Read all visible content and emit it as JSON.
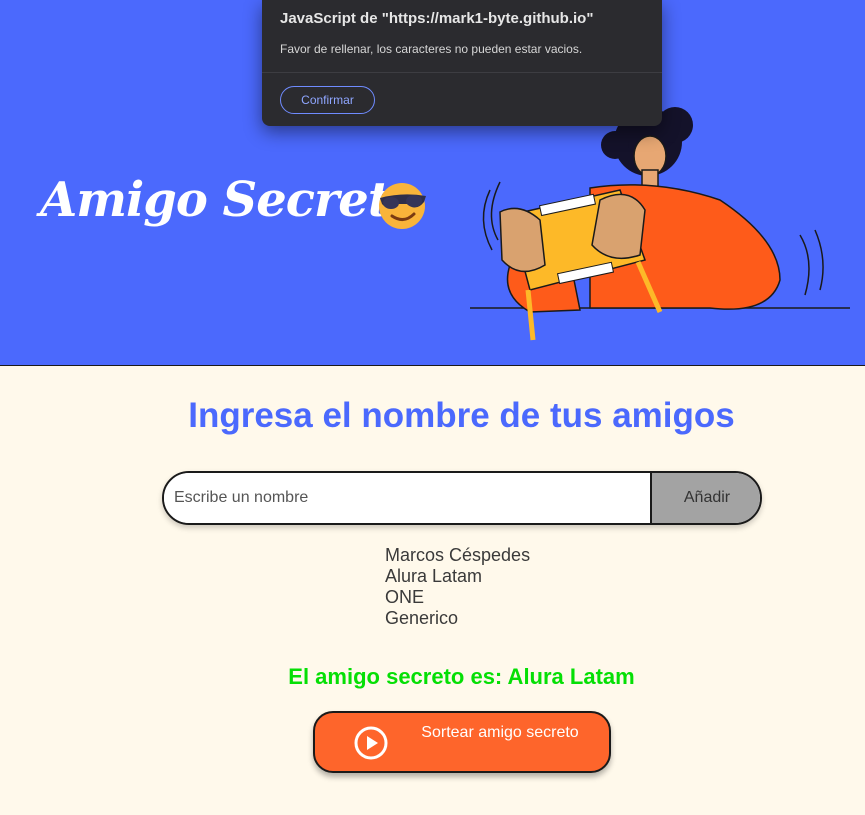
{
  "dialog": {
    "title": "JavaScript de \"https://mark1-byte.github.io\"",
    "message": "Favor de rellenar, los caracteres no pueden estar vacios.",
    "confirm_label": "Confirmar"
  },
  "header": {
    "title": "Amigo Secreto",
    "emoji_icon": "sunglasses-emoji-icon",
    "illustration_icon": "person-holding-gift-box-illustration"
  },
  "main": {
    "title": "Ingresa el nombre de tus amigos",
    "input_placeholder": "Escribe un nombre",
    "input_value": "",
    "add_label": "Añadir",
    "friends": [
      "Marcos Céspedes",
      "Alura Latam",
      "ONE",
      "Generico"
    ],
    "result": "El amigo secreto es: Alura Latam",
    "draw_label": "Sortear amigo secreto",
    "draw_icon": "play-circle-icon"
  },
  "colors": {
    "header_bg": "#4b69fd",
    "page_bg": "#fff9eb",
    "title_blue": "#4b69fd",
    "result_green": "#05df05",
    "draw_button": "#fe652b",
    "add_button": "#a3a3a3"
  }
}
